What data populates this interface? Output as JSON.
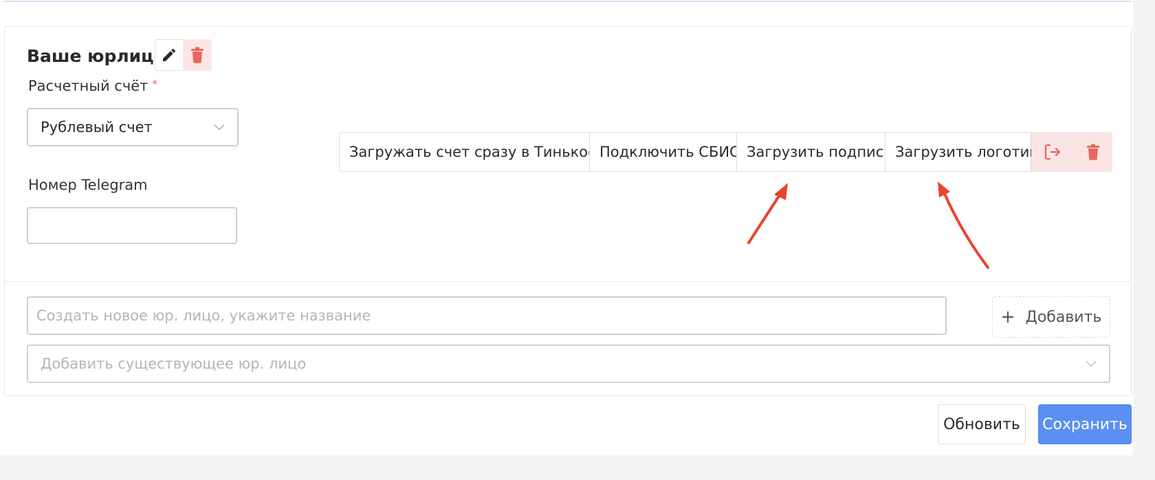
{
  "card": {
    "title": "Ваше юрлицо"
  },
  "account_field": {
    "label": "Расчетный счёт",
    "required_mark": "*",
    "value": "Рублевый счет"
  },
  "telegram_field": {
    "label": "Номер Telegram",
    "value": ""
  },
  "actions": {
    "tinkoff": "Загружать счет сразу в Тинькофф",
    "sbis": "Подключить СБИС",
    "signature": "Загрузить подпись",
    "logo": "Загрузить логотип"
  },
  "create_entity": {
    "placeholder": "Создать новое юр. лицо, укажите название",
    "add_label": "Добавить"
  },
  "existing_entity": {
    "placeholder": "Добавить существующее юр. лицо"
  },
  "footer": {
    "refresh_label": "Обновить",
    "save_label": "Сохранить"
  },
  "colors": {
    "primary": "#5b8ff1",
    "danger": "#e8665f",
    "danger_bg": "#fbe4e4",
    "annotation": "#e8452c"
  },
  "icons": [
    "pencil-icon",
    "trash-icon",
    "logout-icon",
    "plus-icon",
    "chevron-down-icon"
  ]
}
